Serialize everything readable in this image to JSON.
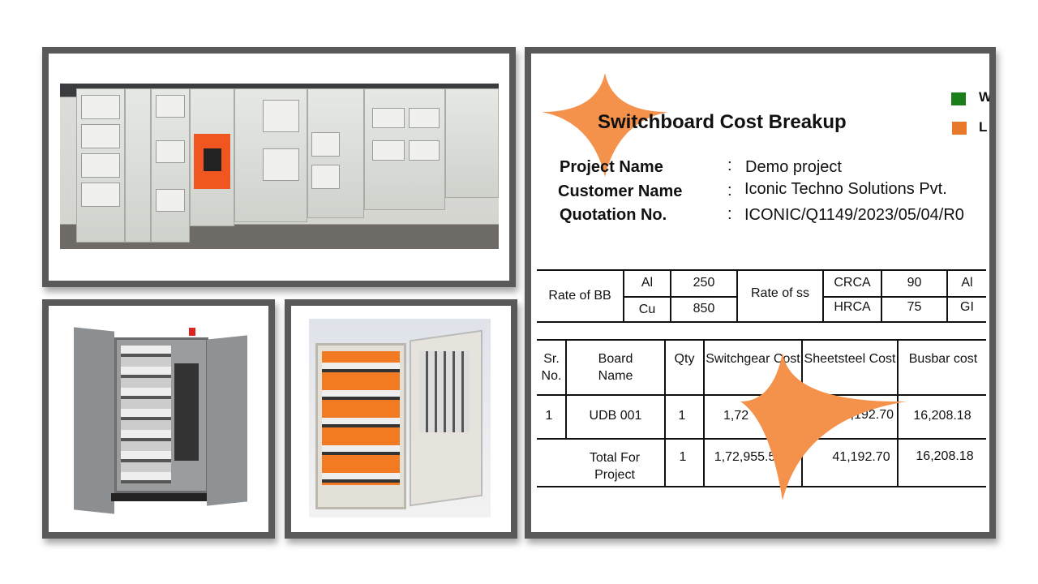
{
  "document": {
    "title": "Switchboard Cost Breakup",
    "legend": [
      {
        "label": "W",
        "color": "#1a7f1a"
      },
      {
        "label": "L",
        "color": "#e8782a"
      }
    ],
    "fields": [
      {
        "label": "Project Name",
        "sep": ":",
        "value": "Demo project"
      },
      {
        "label": "Customer Name",
        "sep": ":",
        "value": "Iconic Techno Solutions Pvt."
      },
      {
        "label": "Quotation No.",
        "sep": ":",
        "value": "ICONIC/Q1149/2023/05/04/R0"
      }
    ],
    "rates": {
      "bb_label": "Rate of BB",
      "bb": [
        {
          "material": "Al",
          "rate": "250"
        },
        {
          "material": "Cu",
          "rate": "850"
        }
      ],
      "ss_label": "Rate of ss",
      "ss": [
        {
          "material": "CRCA",
          "rate": "90",
          "extra": "Al"
        },
        {
          "material": "HRCA",
          "rate": "75",
          "extra": "GI"
        }
      ]
    },
    "cost_table": {
      "headers": [
        "Sr. No.",
        "Board Name",
        "Qty",
        "Switchgear Cost",
        "Sheetsteel Cost",
        "Busbar cost"
      ],
      "rows": [
        {
          "sr": "1",
          "board": "UDB 001",
          "qty": "1",
          "switchgear": "1,72",
          "sheetsteel": "1,192.70",
          "busbar": "16,208.18"
        }
      ],
      "total": {
        "label": "Total For Project",
        "qty": "1",
        "switchgear": "1,72,955.50",
        "sheetsteel": "41,192.70",
        "busbar": "16,208.18"
      }
    },
    "accent_color": "#f4914a"
  }
}
